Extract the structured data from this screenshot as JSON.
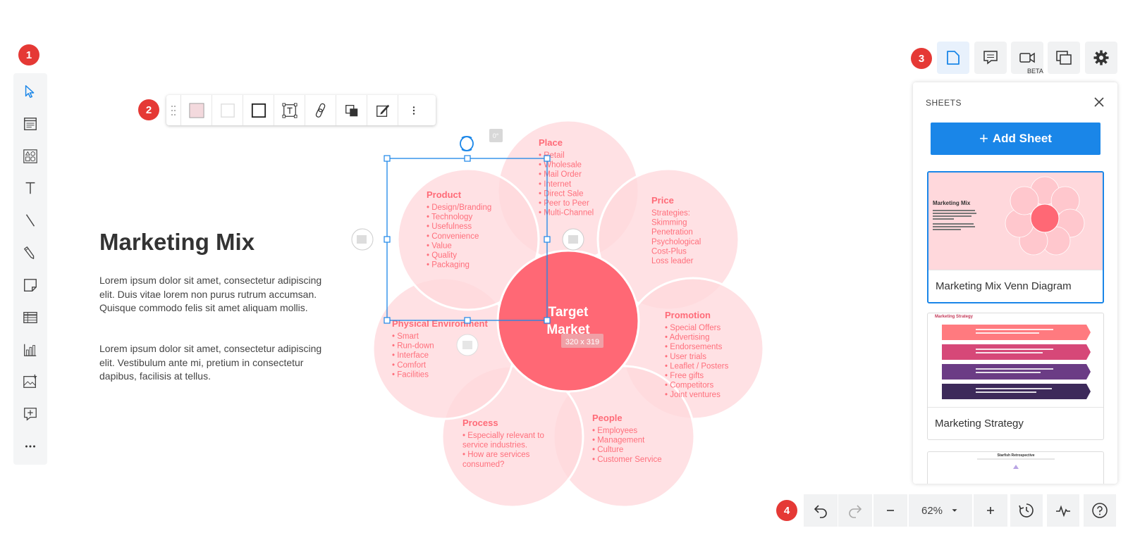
{
  "badges": {
    "b1": "1",
    "b2": "2",
    "b3": "3",
    "b4": "4"
  },
  "document": {
    "title": "Marketing Mix",
    "para1": "Lorem ipsum dolor sit amet, consectetur adipiscing elit. Duis vitae lorem non purus rutrum accumsan. Quisque commodo felis sit amet aliquam mollis.",
    "para2": "Lorem ipsum dolor sit amet, consectetur adipiscing elit. Vestibulum ante mi, pretium in consectetur dapibus, facilisis at tellus."
  },
  "diagram": {
    "center": {
      "line1": "Target",
      "line2": "Market"
    },
    "selection_size": "320 x 319",
    "rotation_label": "0°",
    "circles": [
      {
        "title": "Place",
        "items": [
          "• Retail",
          "• Wholesale",
          "• Mail Order",
          "• Internet",
          "• Direct Sale",
          "• Peer to Peer",
          "• Multi-Channel"
        ]
      },
      {
        "title": "Price",
        "items": [
          "Strategies:",
          "Skimming",
          "Penetration",
          "Psychological",
          "Cost-Plus",
          "Loss leader"
        ]
      },
      {
        "title": "Promotion",
        "items": [
          "• Special Offers",
          "• Advertising",
          "• Endorsements",
          "• User trials",
          "• Leaflet / Posters",
          "• Free gifts",
          "• Competitors",
          "• Joint ventures"
        ]
      },
      {
        "title": "People",
        "items": [
          "• Employees",
          "• Management",
          "• Culture",
          "• Customer Service"
        ]
      },
      {
        "title": "Process",
        "items": [
          "• Especially relevant to",
          "service industries.",
          "• How are services",
          "consumed?"
        ]
      },
      {
        "title": "Physical Environment",
        "items": [
          "• Smart",
          "• Run-down",
          "• Interface",
          "• Comfort",
          "• Facilities"
        ]
      },
      {
        "title": "Product",
        "items": [
          "• Design/Branding",
          "• Technology",
          "• Usefulness",
          "• Convenience",
          "• Value",
          "• Quality",
          "• Packaging"
        ]
      }
    ]
  },
  "header": {
    "beta_label": "BETA"
  },
  "sheets": {
    "title": "SHEETS",
    "add_label": "Add Sheet",
    "items": [
      {
        "name": "Marketing Mix Venn Diagram",
        "thumb_title": "Marketing Mix"
      },
      {
        "name": "Marketing Strategy",
        "thumb_title": "Marketing Strategy"
      },
      {
        "name": "",
        "thumb_title": "Starfish Retrospective"
      }
    ]
  },
  "bottom": {
    "zoom": "62%"
  },
  "colors": {
    "accent": "#1a86e8",
    "badge": "#e53935",
    "petal": "#ffd9dd",
    "center": "#ff6875",
    "petal_text": "#ff6b78"
  },
  "icons": {
    "left": [
      "select-pointer-icon",
      "container-icon",
      "shape-library-icon",
      "text-icon",
      "line-icon",
      "pen-icon",
      "sticky-note-icon",
      "table-icon",
      "chart-icon",
      "image-icon",
      "embed-icon",
      "more-icon"
    ],
    "shape_toolbar": [
      "drag-grip-icon",
      "fill-color-icon",
      "border-color-icon",
      "border-style-icon",
      "text-box-icon",
      "link-icon",
      "arrange-icon",
      "edit-style-icon",
      "more-vertical-icon"
    ],
    "header": [
      "sheets-icon",
      "comment-icon",
      "video-icon",
      "present-icon",
      "settings-icon"
    ],
    "bottom": [
      "undo-icon",
      "redo-icon",
      "zoom-out-icon",
      "zoom-dropdown-icon",
      "zoom-in-icon",
      "history-icon",
      "activity-icon",
      "help-icon"
    ]
  }
}
